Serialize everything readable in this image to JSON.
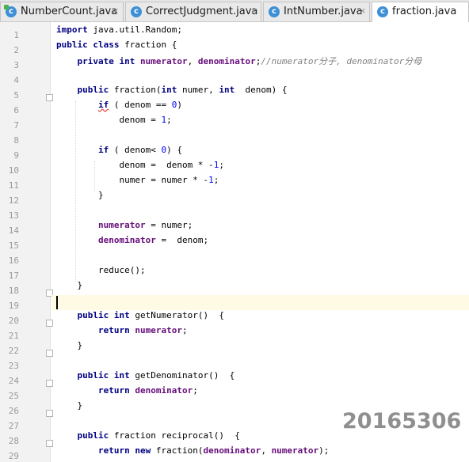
{
  "tabs": [
    {
      "name": "NumberCount.java",
      "icon": "java-class-runnable-icon",
      "active": false
    },
    {
      "name": "CorrectJudgment.java",
      "icon": "java-class-icon",
      "active": false
    },
    {
      "name": "IntNumber.java",
      "icon": "java-class-icon",
      "active": false
    },
    {
      "name": "fraction.java",
      "icon": "java-class-icon",
      "active": true
    }
  ],
  "tab_close_glyph": "×",
  "class_icon_letter": "c",
  "line_numbers": [
    "1",
    "2",
    "3",
    "4",
    "5",
    "6",
    "7",
    "8",
    "9",
    "10",
    "11",
    "12",
    "13",
    "14",
    "15",
    "16",
    "17",
    "18",
    "19",
    "20",
    "21",
    "22",
    "23",
    "24",
    "25",
    "26",
    "27",
    "28",
    "29"
  ],
  "code_lines": [
    "<span class=\"kw\">import</span> java.util.Random;",
    "<span class=\"kw\">public class</span> fraction {",
    "    <span class=\"kw\">private int</span> <span class=\"fld\">numerator</span>, <span class=\"fld\">denominator</span>;<span class=\"cmt\">//numerator分子, denominator分母</span>",
    "",
    "    <span class=\"kw\">public</span> fraction(<span class=\"kw\">int</span> numer, <span class=\"kw\">int</span>  denom) {",
    "        <span class=\"kw squig\">if</span> ( denom == <span class=\"num\">0</span>)",
    "            denom = <span class=\"num\">1</span>;",
    "",
    "        <span class=\"kw\">if</span> ( denom&lt; <span class=\"num\">0</span>) {",
    "            denom =  denom * -<span class=\"num\">1</span>;",
    "            numer = numer * -<span class=\"num\">1</span>;",
    "        }",
    "",
    "        <span class=\"fld\">numerator</span> = numer;",
    "        <span class=\"fld\">denominator</span> =  denom;",
    "",
    "        reduce();",
    "    }",
    "",
    "    <span class=\"kw\">public int</span> getNumerator()  {",
    "        <span class=\"kw\">return</span> <span class=\"fld\">numerator</span>;",
    "    }",
    "",
    "    <span class=\"kw\">public int</span> getDenominator()  {",
    "        <span class=\"kw\">return</span> <span class=\"fld\">denominator</span>;",
    "    }",
    "",
    "    <span class=\"kw\">public</span> fraction reciprocal()  {",
    "        <span class=\"kw\">return new</span> fraction(<span class=\"fld\">denominator</span>, <span class=\"fld\">numerator</span>);"
  ],
  "current_line": 19,
  "fold_markers_at_lines": [
    5,
    18,
    20,
    22,
    24,
    26,
    28
  ],
  "watermark": "20165306",
  "colors": {
    "keyword": "#000080",
    "field": "#660e7a",
    "comment": "#808080",
    "number": "#0000ff",
    "current_line_bg": "#fffae3",
    "gutter_bg": "#f2f2f2",
    "tab_bar_bg": "#e6e6e6"
  }
}
